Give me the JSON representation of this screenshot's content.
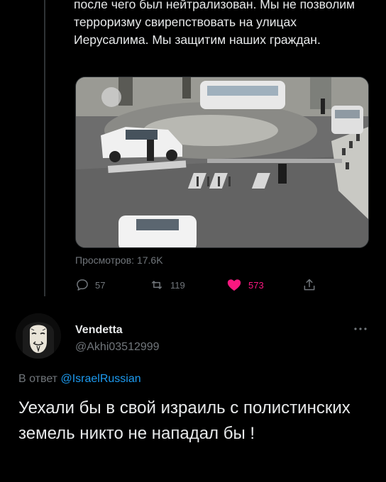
{
  "tweet": {
    "text": "после чего был нейтрализован. Мы не позволим терроризму свирепствовать на улицах Иерусалима. Мы защитим наших граждан.",
    "views_label": "Просмотров: 17.6K",
    "media_icon": "video-thumbnail",
    "actions": {
      "reply_icon": "reply-icon",
      "reply_count": "57",
      "retweet_icon": "retweet-icon",
      "retweet_count": "119",
      "like_icon": "heart-filled-icon",
      "like_count": "573",
      "share_icon": "share-icon"
    }
  },
  "reply": {
    "author_name": "Vendetta",
    "author_handle": "@Akhi03512999",
    "more_icon": "more-icon",
    "reply_to_prefix": "В ответ",
    "reply_to_mention": "@IsraelRussian",
    "text": "Уехали бы в свой израиль с полистинских земель никто не нападал бы !"
  },
  "colors": {
    "background": "#000000",
    "text": "#e7e9ea",
    "secondary": "#71767b",
    "link": "#1d9bf0",
    "like": "#f91880"
  }
}
